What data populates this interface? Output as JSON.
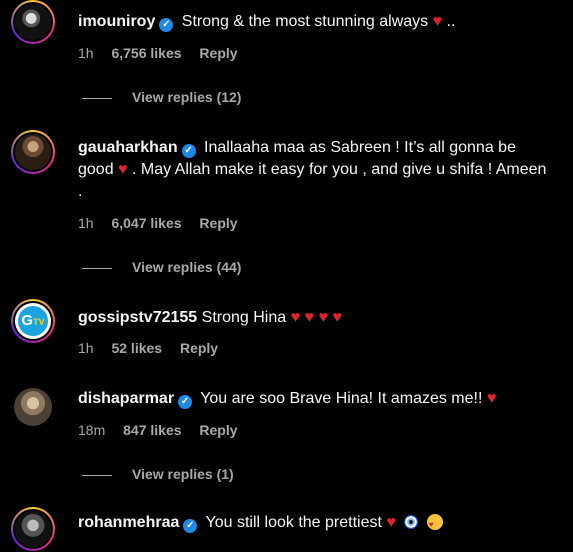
{
  "comments": [
    {
      "username": "imouniroy",
      "verified": true,
      "text": "Strong & the most stunning always",
      "text_suffix": " ..",
      "time": "1h",
      "likes": "6,756 likes",
      "reply": "Reply",
      "view_replies": "View replies (12)"
    },
    {
      "username": "gauaharkhan",
      "verified": true,
      "text_part1": "Inallaaha maa as Sabreen ! It’s all gonna be good",
      "text_part2": ". May Allah make it easy for you , and give u shifa ! Ameen .",
      "time": "1h",
      "likes": "6,047 likes",
      "reply": "Reply",
      "view_replies": "View replies (44)"
    },
    {
      "username": "gossipstv72155",
      "verified": false,
      "text": "Strong Hina",
      "time": "1h",
      "likes": "52 likes",
      "reply": "Reply"
    },
    {
      "username": "dishaparmar",
      "verified": true,
      "text": "You are soo Brave Hina! It amazes me!!",
      "time": "18m",
      "likes": "847 likes",
      "reply": "Reply",
      "view_replies": "View replies (1)"
    },
    {
      "username": "rohanmehraa",
      "verified": true,
      "text": "You still look the prettiest"
    }
  ],
  "icons": {
    "verified": "verified-badge-icon",
    "heart": "red-heart-emoji",
    "evil_eye": "nazar-amulet-emoji",
    "smiling_hearts": "smiling-face-with-hearts-emoji"
  },
  "colors": {
    "background": "#000000",
    "primary_text": "#f5f5f5",
    "secondary_text": "#a8a8a8",
    "verified_blue": "#1e88e5",
    "heart_red": "#e0242d"
  }
}
